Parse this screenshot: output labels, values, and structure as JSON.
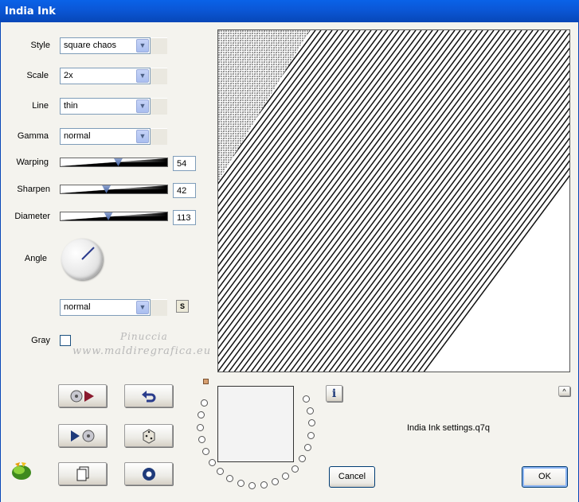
{
  "window": {
    "title": "India Ink"
  },
  "controls": {
    "style": {
      "label": "Style",
      "value": "square chaos"
    },
    "scale": {
      "label": "Scale",
      "value": "2x"
    },
    "line": {
      "label": "Line",
      "value": "thin"
    },
    "gamma": {
      "label": "Gamma",
      "value": "normal"
    },
    "warping": {
      "label": "Warping",
      "value": "54",
      "level": 0.54
    },
    "sharpen": {
      "label": "Sharpen",
      "value": "42",
      "level": 0.42
    },
    "diameter": {
      "label": "Diameter",
      "value": "113",
      "level": 0.44
    },
    "angle": {
      "label": "Angle"
    },
    "blend": {
      "value": "normal",
      "s_label": "S"
    },
    "gray": {
      "label": "Gray",
      "checked": false
    }
  },
  "watermark": {
    "line1": "Pinuccia",
    "line2": "www.maldiregrafica.eu"
  },
  "footer": {
    "settings_file": "India Ink settings.q7q",
    "cancel_label": "Cancel",
    "ok_label": "OK",
    "info_label": "i",
    "collapse_label": "^"
  },
  "colors": {
    "titlebar": "#0A62E8",
    "window_bg": "#F4F3EE",
    "input_border": "#7F9DB9",
    "button_border": "#003C74"
  }
}
